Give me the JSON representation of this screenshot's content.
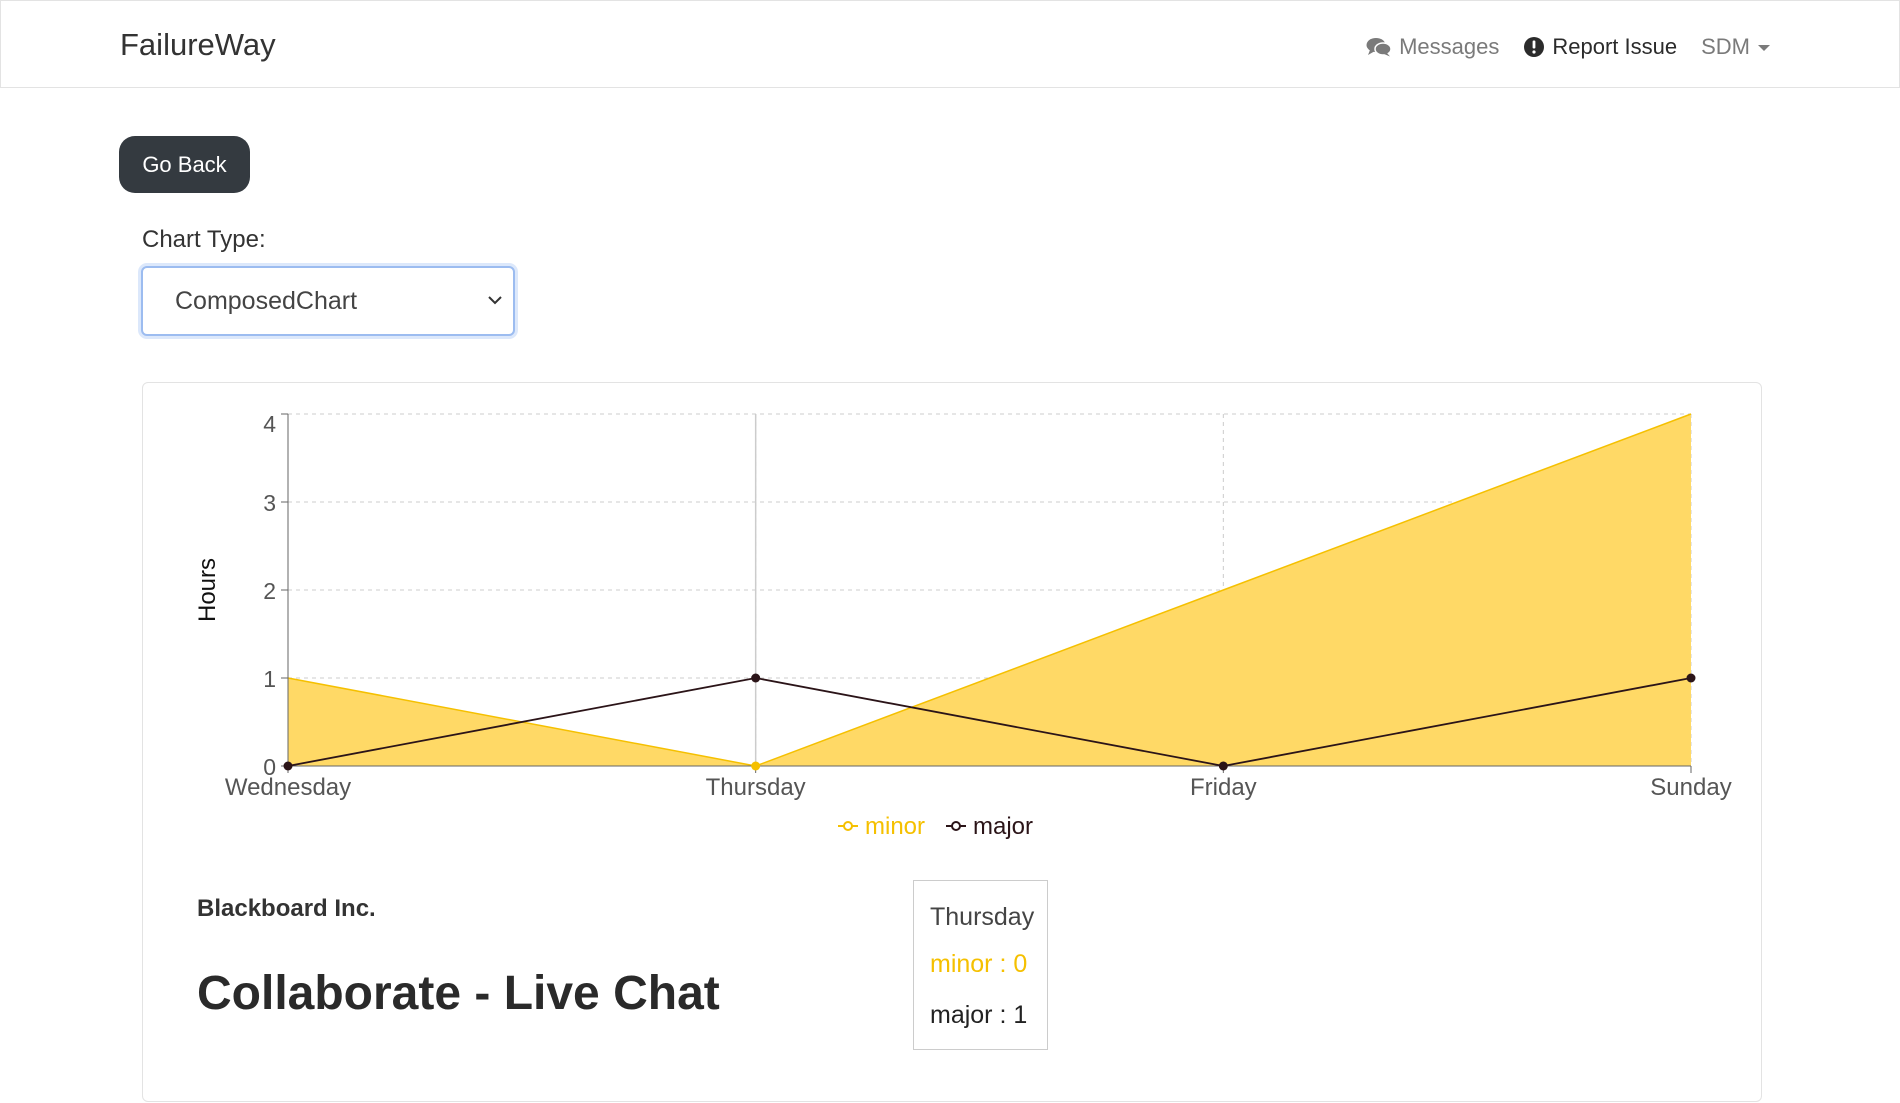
{
  "navbar": {
    "brand": "FailureWay",
    "messages": "Messages",
    "report_issue": "Report Issue",
    "user": "SDM"
  },
  "go_back": "Go Back",
  "chart_type": {
    "label": "Chart Type:",
    "selected": "ComposedChart"
  },
  "tooltip": {
    "title": "Thursday",
    "minor": "minor : 0",
    "major": "major : 1"
  },
  "company": "Blackboard Inc.",
  "app_title": "Collaborate - Live Chat",
  "colors": {
    "minor": "#f5c000",
    "minor_fill": "#ffd966",
    "major": "#2b1418"
  },
  "chart_data": {
    "type": "composed",
    "categories": [
      "Wednesday",
      "Thursday",
      "Friday",
      "Sunday"
    ],
    "series": [
      {
        "name": "minor",
        "type": "area",
        "values": [
          1,
          0,
          2,
          4
        ]
      },
      {
        "name": "major",
        "type": "line",
        "values": [
          0,
          1,
          0,
          1
        ]
      }
    ],
    "ylabel": "Hours",
    "yticks": [
      0,
      1,
      2,
      3,
      4
    ],
    "ylim": [
      0,
      4
    ],
    "grid": true,
    "legend": "bottom-center"
  }
}
